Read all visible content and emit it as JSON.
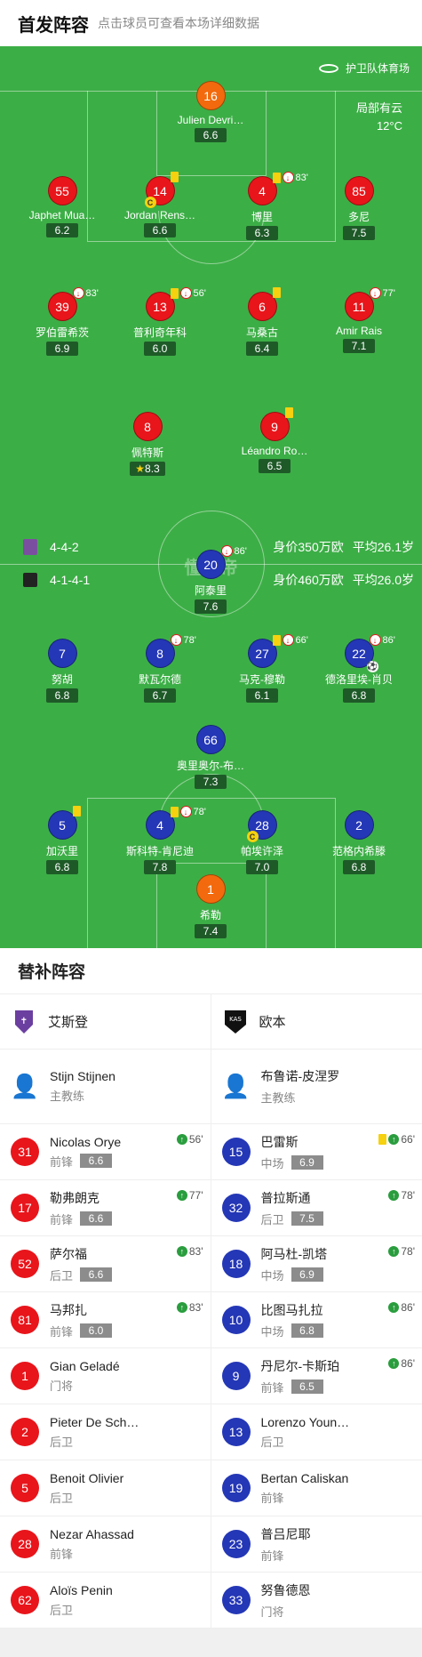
{
  "header": {
    "title": "首发阵容",
    "subtitle": "点击球员可查看本场详细数据"
  },
  "pitch": {
    "venue": "护卫队体育场",
    "weather": "局部有云",
    "temp": "12°C",
    "watermark": "懂球帝",
    "home": {
      "formation": "4-4-2",
      "value": "身价350万欧",
      "age": "平均26.1岁"
    },
    "away": {
      "formation": "4-1-4-1",
      "value": "身价460万欧",
      "age": "平均26.0岁"
    },
    "players": [
      {
        "num": "16",
        "name": "Julien Devri…",
        "rating": "6.6",
        "color": "orange"
      },
      {
        "num": "55",
        "name": "Japhet Mua…",
        "rating": "6.2",
        "color": "red"
      },
      {
        "num": "14",
        "name": "Jordan Rens…",
        "rating": "6.6",
        "color": "red",
        "yc": true,
        "cap": true
      },
      {
        "num": "4",
        "name": "博里",
        "rating": "6.3",
        "color": "red",
        "yc": true,
        "so": true,
        "min": "83'"
      },
      {
        "num": "85",
        "name": "多尼",
        "rating": "7.5",
        "color": "red"
      },
      {
        "num": "39",
        "name": "罗伯雷希茨",
        "rating": "6.9",
        "color": "red",
        "so": true,
        "min": "83'"
      },
      {
        "num": "13",
        "name": "普利奇年科",
        "rating": "6.0",
        "color": "red",
        "yc": true,
        "so": true,
        "min": "56'"
      },
      {
        "num": "6",
        "name": "马桑古",
        "rating": "6.4",
        "color": "red",
        "yc": true
      },
      {
        "num": "11",
        "name": "Amir Rais",
        "rating": "7.1",
        "color": "red",
        "so": true,
        "min": "77'"
      },
      {
        "num": "8",
        "name": "佩特斯",
        "rating": "8.3",
        "color": "red",
        "star": true
      },
      {
        "num": "9",
        "name": "Léandro Ro…",
        "rating": "6.5",
        "color": "red",
        "yc": true
      },
      {
        "num": "20",
        "name": "阿泰里",
        "rating": "7.6",
        "color": "blue",
        "so": true,
        "min": "86'"
      },
      {
        "num": "7",
        "name": "努胡",
        "rating": "6.8",
        "color": "blue"
      },
      {
        "num": "8",
        "name": "默瓦尔德",
        "rating": "6.7",
        "color": "blue",
        "so": true,
        "min": "78'"
      },
      {
        "num": "27",
        "name": "马克-穆勒",
        "rating": "6.1",
        "color": "blue",
        "yc": true,
        "so": true,
        "min": "66'"
      },
      {
        "num": "22",
        "name": "德洛里埃-肖贝",
        "rating": "6.8",
        "color": "blue",
        "so": true,
        "min": "86'",
        "goal": true
      },
      {
        "num": "66",
        "name": "奥里奥尔-布…",
        "rating": "7.3",
        "color": "blue"
      },
      {
        "num": "5",
        "name": "加沃里",
        "rating": "6.8",
        "color": "blue",
        "yc": true
      },
      {
        "num": "4",
        "name": "斯科特-肯尼迪",
        "rating": "7.8",
        "color": "blue",
        "yc": true,
        "so": true,
        "min": "78'"
      },
      {
        "num": "28",
        "name": "帕埃许泽",
        "rating": "7.0",
        "color": "blue",
        "cap": true
      },
      {
        "num": "2",
        "name": "范格内希滕",
        "rating": "6.8",
        "color": "blue"
      },
      {
        "num": "1",
        "name": "希勒",
        "rating": "7.4",
        "color": "orange"
      }
    ]
  },
  "subs": {
    "title": "替补阵容",
    "left": {
      "team": "艾斯登",
      "coach": {
        "name": "Stijn Stijnen",
        "role": "主教练"
      },
      "players": [
        {
          "num": "31",
          "name": "Nicolas Orye",
          "pos": "前锋",
          "rating": "6.6",
          "in": "56'"
        },
        {
          "num": "17",
          "name": "勒弗朗克",
          "pos": "前锋",
          "rating": "6.6",
          "in": "77'"
        },
        {
          "num": "52",
          "name": "萨尔福",
          "pos": "后卫",
          "rating": "6.6",
          "in": "83'"
        },
        {
          "num": "81",
          "name": "马邦扎",
          "pos": "前锋",
          "rating": "6.0",
          "in": "83'"
        },
        {
          "num": "1",
          "name": "Gian Geladé",
          "pos": "门将"
        },
        {
          "num": "2",
          "name": "Pieter De Sch…",
          "pos": "后卫"
        },
        {
          "num": "5",
          "name": "Benoit Olivier",
          "pos": "后卫"
        },
        {
          "num": "28",
          "name": "Nezar Ahassad",
          "pos": "前锋"
        },
        {
          "num": "62",
          "name": "Aloïs Penin",
          "pos": "后卫"
        }
      ]
    },
    "right": {
      "team": "欧本",
      "coach": {
        "name": "布鲁诺-皮涅罗",
        "role": "主教练"
      },
      "players": [
        {
          "num": "15",
          "name": "巴雷斯",
          "pos": "中场",
          "rating": "6.9",
          "in": "66'",
          "yc": true
        },
        {
          "num": "32",
          "name": "普拉斯通",
          "pos": "后卫",
          "rating": "7.5",
          "in": "78'"
        },
        {
          "num": "18",
          "name": "阿马杜-凯塔",
          "pos": "中场",
          "rating": "6.9",
          "in": "78'"
        },
        {
          "num": "10",
          "name": "比图马扎拉",
          "pos": "中场",
          "rating": "6.8",
          "in": "86'"
        },
        {
          "num": "9",
          "name": "丹尼尔-卡斯珀",
          "pos": "前锋",
          "rating": "6.5",
          "in": "86'"
        },
        {
          "num": "13",
          "name": "Lorenzo Youn…",
          "pos": "后卫"
        },
        {
          "num": "19",
          "name": "Bertan Caliskan",
          "pos": "前锋"
        },
        {
          "num": "23",
          "name": "普吕尼耶",
          "pos": "前锋"
        },
        {
          "num": "33",
          "name": "努鲁德恩",
          "pos": "门将"
        }
      ]
    }
  }
}
